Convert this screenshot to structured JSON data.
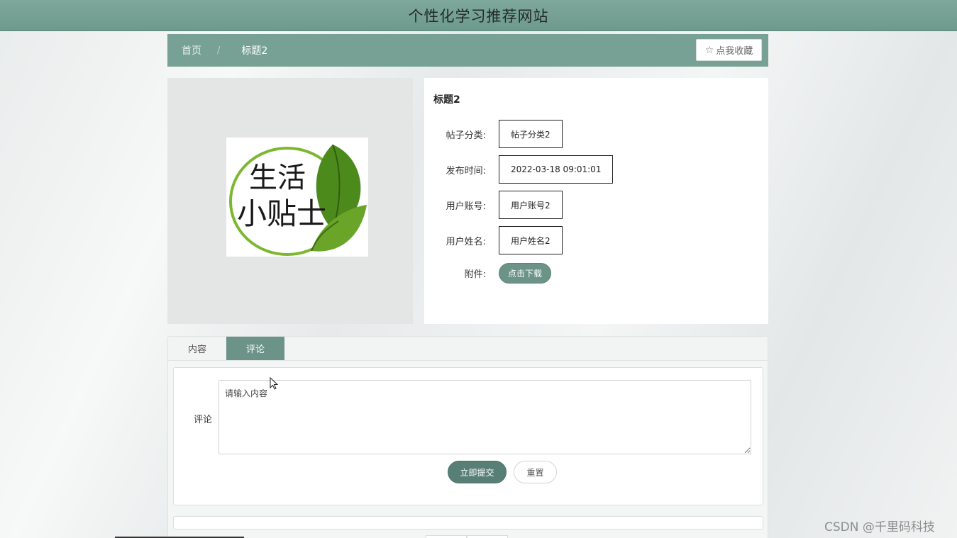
{
  "header": {
    "title": "个性化学习推荐网站"
  },
  "nav": {
    "home": "首页",
    "separator": "/",
    "current": "标题2",
    "favorite_label": "点我收藏"
  },
  "logo": {
    "line1": "生活",
    "line2": "小贴士"
  },
  "detail": {
    "title": "标题2",
    "fields": [
      {
        "label": "帖子分类:",
        "value": "帖子分类2"
      },
      {
        "label": "发布时间:",
        "value": "2022-03-18 09:01:01"
      },
      {
        "label": "用户账号:",
        "value": "用户账号2"
      },
      {
        "label": "用户姓名:",
        "value": "用户姓名2"
      }
    ],
    "attachment_label": "附件:",
    "download_label": "点击下载"
  },
  "tabs": [
    {
      "label": "内容",
      "active": false
    },
    {
      "label": "评论",
      "active": true
    }
  ],
  "comment": {
    "label": "评论",
    "placeholder": "请输入内容",
    "submit_label": "立即提交",
    "reset_label": "重置"
  },
  "watermark": "CSDN @千里码科技",
  "colors": {
    "accent": "#6b9387",
    "header": "#77a195"
  }
}
